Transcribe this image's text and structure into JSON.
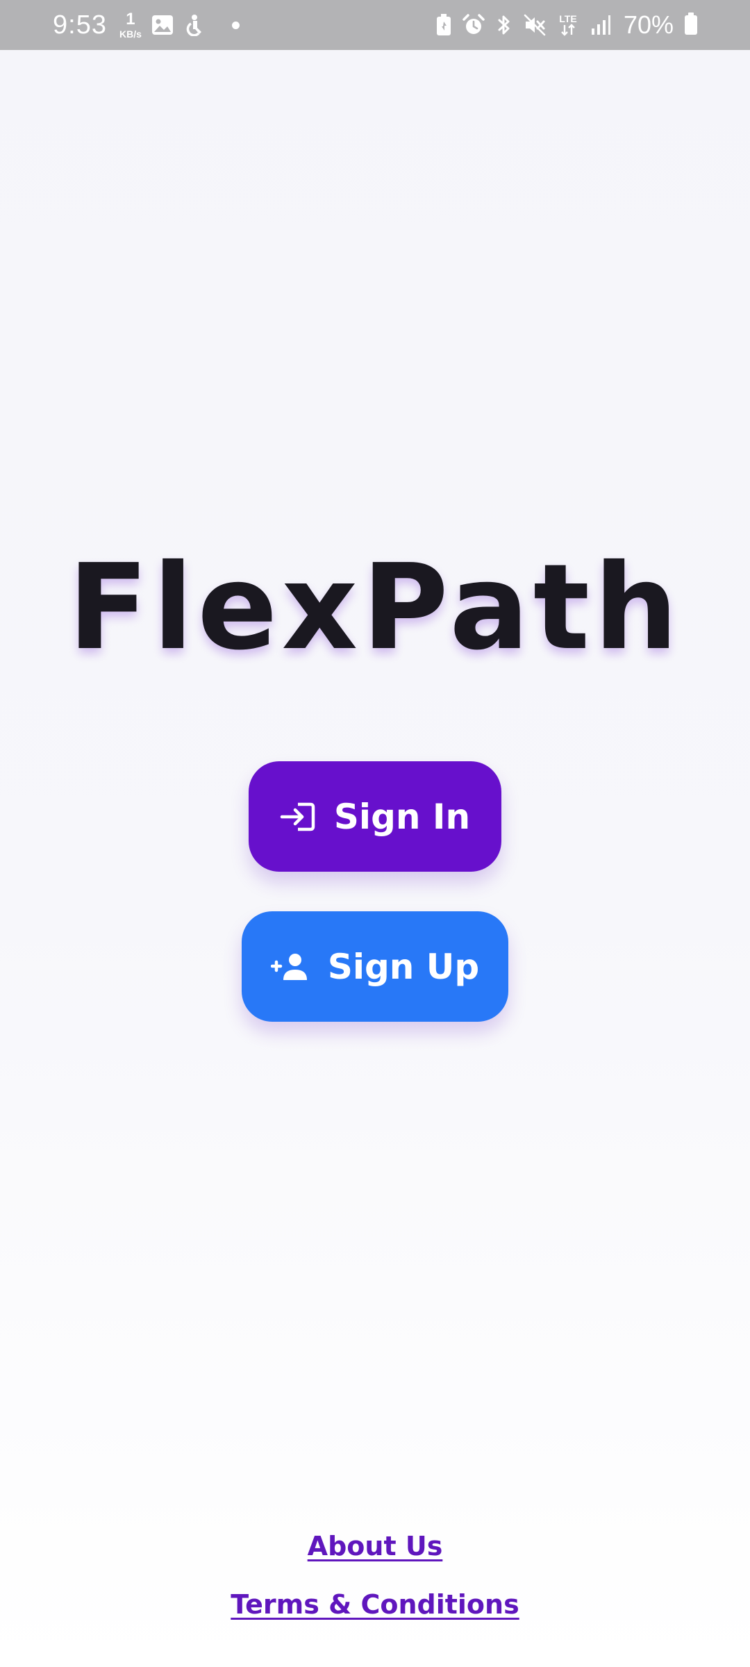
{
  "status_bar": {
    "time": "9:53",
    "net_speed_value": "1",
    "net_speed_unit": "KB/s",
    "battery_percent": "70%",
    "icons": [
      "gallery-icon",
      "accessibility-icon",
      "notification-dot",
      "battery-saver-icon",
      "alarm-icon",
      "bluetooth-icon",
      "mute-icon",
      "lte-icon",
      "signal-icon",
      "battery-icon"
    ],
    "network_type": "LTE"
  },
  "app": {
    "title": "FlexPath"
  },
  "actions": {
    "sign_in_label": "Sign In",
    "sign_up_label": "Sign Up"
  },
  "footer": {
    "about_label": "About Us",
    "terms_label": "Terms & Conditions"
  },
  "colors": {
    "status_bar_bg": "#b3b3b5",
    "sign_in_bg": "#6710cc",
    "sign_up_bg": "#2878f7",
    "title_text": "#1a1820",
    "link_text": "#5f16bd"
  }
}
